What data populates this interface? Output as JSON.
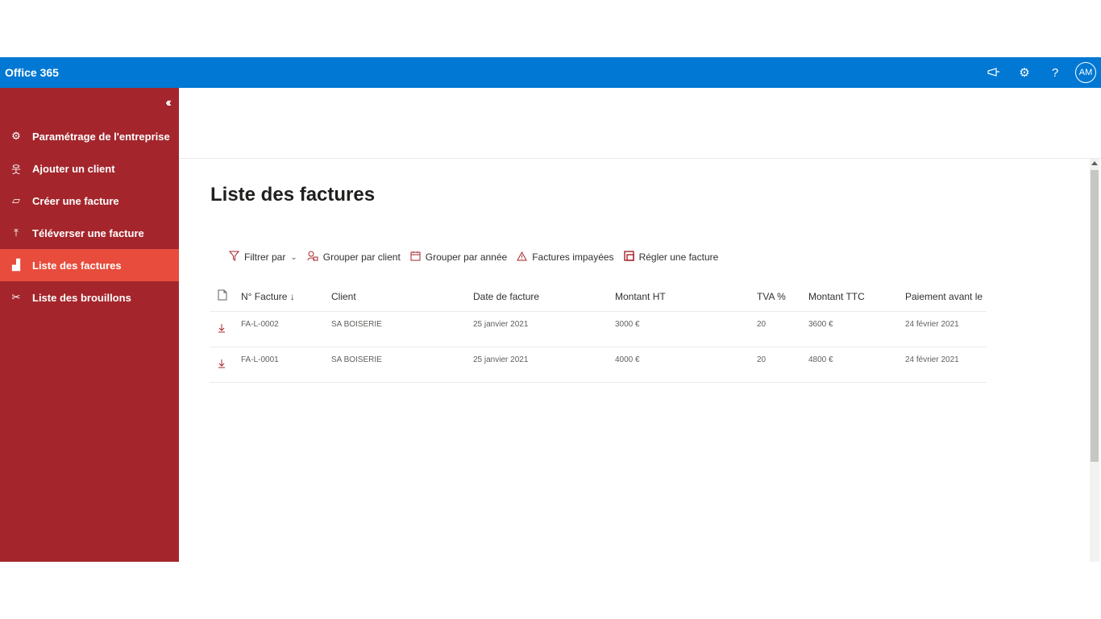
{
  "suite": {
    "title": "Office 365",
    "icons": [
      "megaphone-icon",
      "gear-icon",
      "help-icon"
    ],
    "avatar_initials": "AM"
  },
  "sidebar": {
    "collapse_icon": "double-chevron-left-icon",
    "items": [
      {
        "label": "Paramétrage de l'entreprise",
        "icon": "gear-icon",
        "glyph": "⚙"
      },
      {
        "label": "Ajouter un client",
        "icon": "add-person-icon",
        "glyph": "웃"
      },
      {
        "label": "Créer une facture",
        "icon": "edit-note-icon",
        "glyph": "▱"
      },
      {
        "label": "Téléverser une facture",
        "icon": "upload-icon",
        "glyph": "⤒"
      },
      {
        "label": "Liste des factures",
        "icon": "chart-icon",
        "glyph": "▟",
        "active": true
      },
      {
        "label": "Liste des brouillons",
        "icon": "scissors-icon",
        "glyph": "✂"
      }
    ]
  },
  "page": {
    "title": "Liste des factures"
  },
  "toolbar": {
    "filter": "Filtrer par",
    "group_client": "Grouper par client",
    "group_year": "Grouper par année",
    "unpaid": "Factures impayées",
    "settle": "Régler une facture"
  },
  "table": {
    "columns": [
      "N° Facture ↓",
      "Client",
      "Date de facture",
      "Montant HT",
      "TVA %",
      "Montant TTC",
      "Paiement avant le"
    ],
    "rows": [
      {
        "number": "FA-L-0002",
        "client": "SA BOISERIE",
        "date": "25 janvier 2021",
        "ht": "3000 €",
        "tva": "20",
        "ttc": "3600 €",
        "due": "24 février 2021"
      },
      {
        "number": "FA-L-0001",
        "client": "SA BOISERIE",
        "date": "25 janvier 2021",
        "ht": "4000 €",
        "tva": "20",
        "ttc": "4800 €",
        "due": "24 février 2021"
      }
    ]
  },
  "colors": {
    "suite_bar": "#0078d4",
    "sidebar": "#a4262c",
    "active_item": "#e74c3c"
  }
}
